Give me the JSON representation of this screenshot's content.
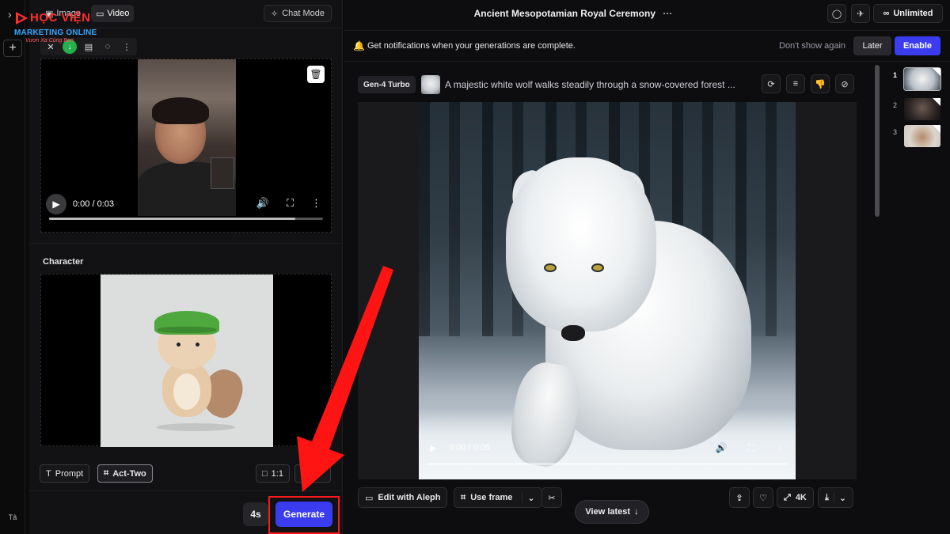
{
  "brand": {
    "name": "HỌC VIỆN",
    "subtitle": "MARKETING ONLINE",
    "tagline": "Vươn Xa Cùng Bạn"
  },
  "rail": {
    "user_initials": "Tâ"
  },
  "left_panel": {
    "tabs": [
      {
        "label": "Image",
        "icon": "image-icon",
        "active": false
      },
      {
        "label": "Video",
        "icon": "video-icon",
        "active": true
      }
    ],
    "chat_mode_label": "Chat Mode",
    "driving_video": {
      "time": "0:00 / 0:03",
      "progress": 0.9
    },
    "character_label": "Character",
    "mode_buttons": [
      {
        "label": "Prompt",
        "active": false
      },
      {
        "label": "Act-Two",
        "active": true
      }
    ],
    "aspect_label": "1:1",
    "duration": "4s",
    "generate_label": "Generate"
  },
  "header": {
    "title": "Ancient Mesopotamian Royal Ceremony",
    "more_label": "···",
    "unlimited_label": "Unlimited"
  },
  "notification": {
    "message": "Get notifications when your generations are complete.",
    "dont_show": "Don't show again",
    "later": "Later",
    "enable": "Enable"
  },
  "generation": {
    "model": "Gen-4 Turbo",
    "prompt": "A majestic white wolf walks steadily through a snow-covered forest ...",
    "video_time": "0:00 / 0:05",
    "edit_label": "Edit with Aleph",
    "use_frame_label": "Use frame",
    "resolution_label": "4K",
    "view_latest": "View latest"
  },
  "thumbnails": [
    {
      "num": "1",
      "active": true
    },
    {
      "num": "2",
      "active": false
    },
    {
      "num": "3",
      "active": false
    }
  ],
  "colors": {
    "accent": "#3b3cf0",
    "highlight": "#ff1a1a",
    "success": "#23b04d"
  }
}
